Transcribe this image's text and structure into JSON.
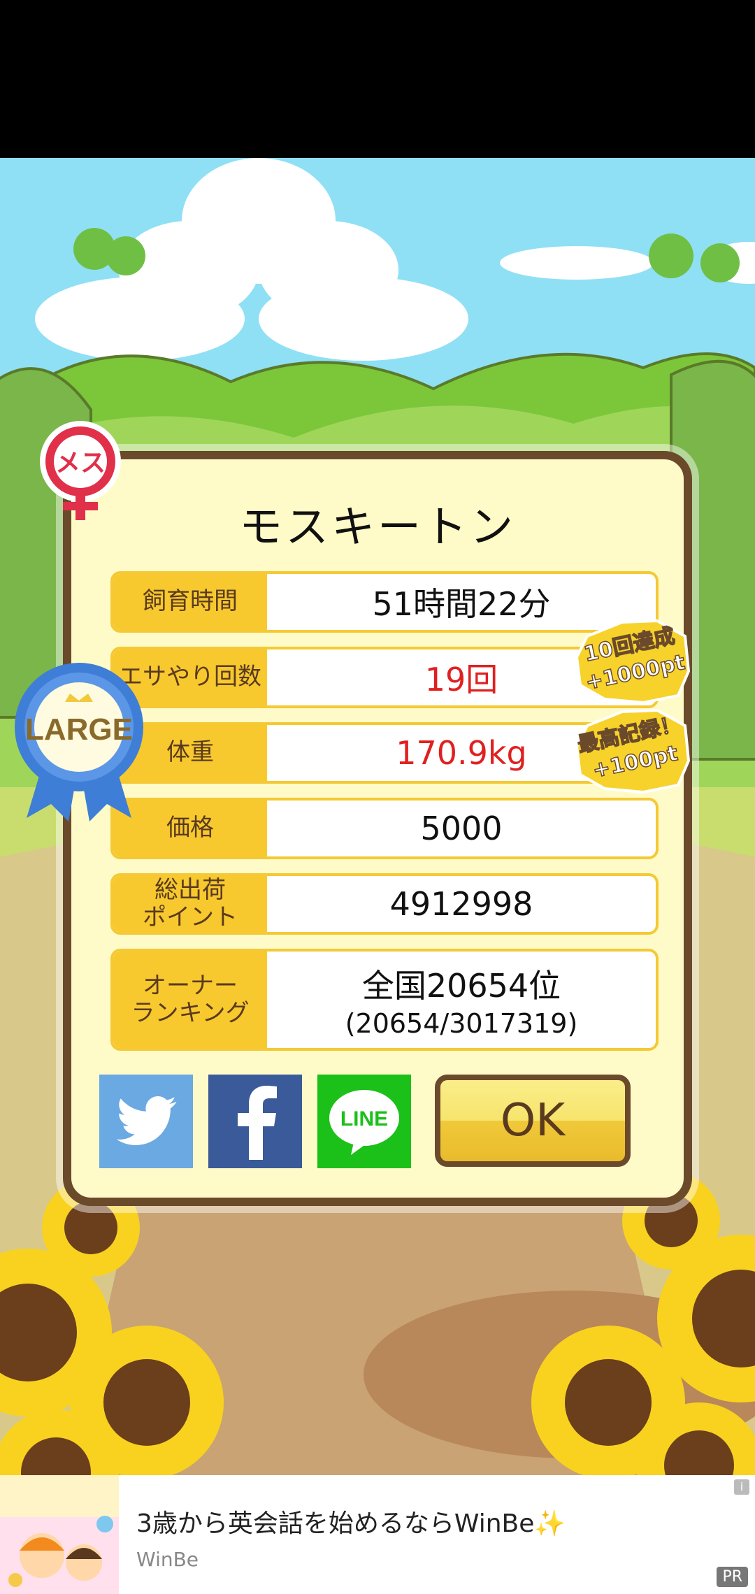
{
  "pig": {
    "name": "モスキートン",
    "gender_label": "メス",
    "size_label": "LARGE"
  },
  "stats": [
    {
      "label": "飼育時間",
      "value": "51時間22分",
      "highlight": false
    },
    {
      "label": "エサやり回数",
      "value": "19回",
      "highlight": true
    },
    {
      "label": "体重",
      "value": "170.9kg",
      "highlight": true
    },
    {
      "label": "価格",
      "value": "5000",
      "highlight": false
    },
    {
      "label": "総出荷\nポイント",
      "value": "4912998",
      "highlight": false
    }
  ],
  "ranking": {
    "label": "オーナー\nランキング",
    "value": "全国20654位",
    "detail": "(20654/3017319)"
  },
  "badges": {
    "feeding": {
      "line1": "10回達成",
      "line2": "+1000pt"
    },
    "record": {
      "line1": "最高記録！",
      "line2": "+100pt"
    }
  },
  "share": {
    "twitter_icon": "twitter-bird-icon",
    "facebook_icon": "facebook-f-icon",
    "line_icon": "line-logo-icon",
    "line_text": "LINE"
  },
  "ok_label": "OK",
  "ad": {
    "title": "3歳から英会話を始めるならWinBe✨",
    "advertiser": "WinBe",
    "pr_label": "PR",
    "info_label": "i"
  },
  "colors": {
    "panel_bg": "#fffbc8",
    "panel_border": "#6b4a2b",
    "label_bg": "#f7c92e",
    "highlight_text": "#e02020"
  }
}
